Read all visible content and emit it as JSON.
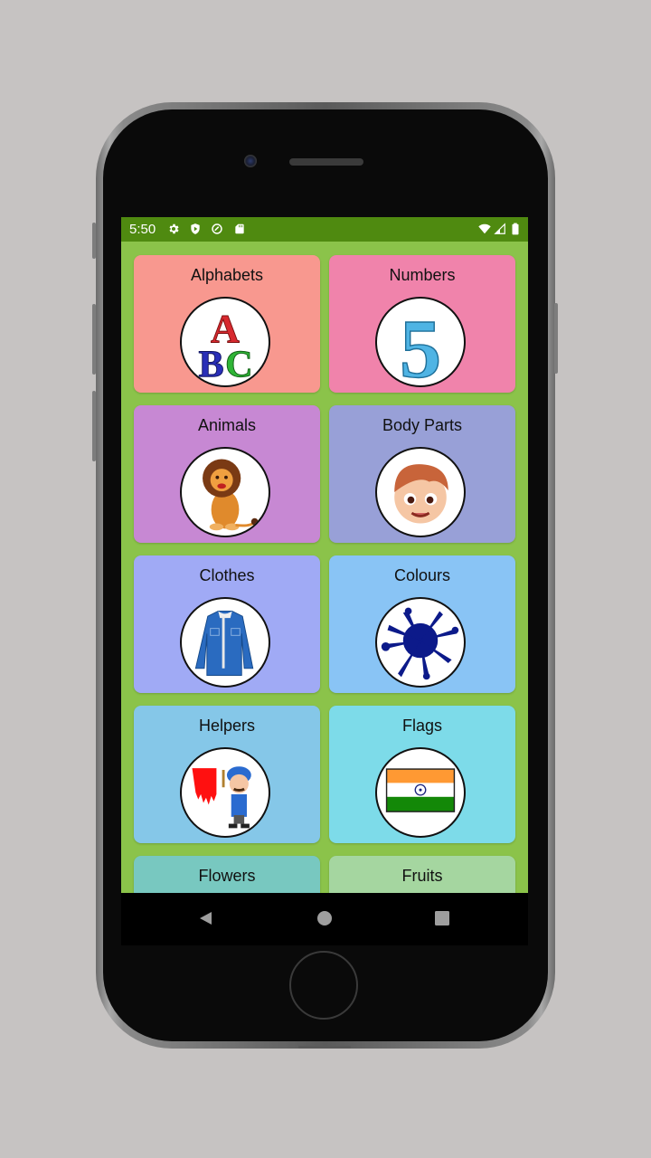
{
  "device": {
    "frame_color": "#5a5a5a",
    "screen_bezel_color": "#0a0a0a"
  },
  "status_bar": {
    "time": "5:50",
    "background": "#4f8a10",
    "left_icons": [
      "settings-icon",
      "play-protect-icon",
      "data-saver-icon",
      "sd-card-icon"
    ],
    "right_icons": [
      "wifi-icon",
      "cellular-signal-icon",
      "battery-icon"
    ]
  },
  "app": {
    "background": "#8bc34a",
    "categories": [
      {
        "label": "Alphabets",
        "color": "#f8988f",
        "image": "abc-letters-icon"
      },
      {
        "label": "Numbers",
        "color": "#f083ab",
        "image": "number-five-icon"
      },
      {
        "label": "Animals",
        "color": "#c788d3",
        "image": "lion-icon"
      },
      {
        "label": "Body Parts",
        "color": "#98a0d7",
        "image": "boy-face-icon"
      },
      {
        "label": "Clothes",
        "color": "#a0aaf5",
        "image": "denim-jacket-icon"
      },
      {
        "label": "Colours",
        "color": "#89c4f5",
        "image": "paint-splash-icon"
      },
      {
        "label": "Helpers",
        "color": "#85c7e8",
        "image": "painter-icon"
      },
      {
        "label": "Flags",
        "color": "#7ddbe9",
        "image": "india-flag-icon"
      },
      {
        "label": "Flowers",
        "color": "#78c8c0",
        "image": ""
      },
      {
        "label": "Fruits",
        "color": "#a5d6a0",
        "image": ""
      }
    ]
  },
  "nav_bar": {
    "buttons": [
      "back",
      "home",
      "recents"
    ]
  }
}
